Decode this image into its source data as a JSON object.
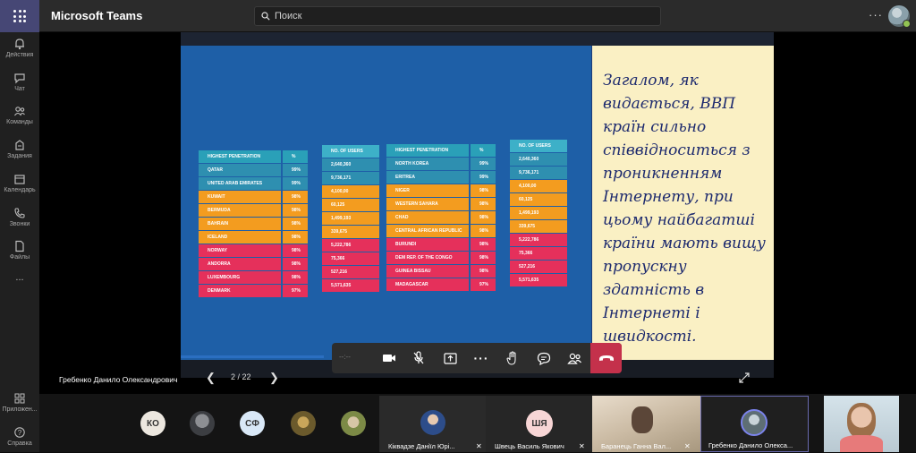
{
  "app": {
    "title": "Microsoft Teams"
  },
  "search": {
    "placeholder": "Поиск"
  },
  "rail": {
    "items": [
      {
        "label": "Действия",
        "icon": "bell-icon"
      },
      {
        "label": "Чат",
        "icon": "chat-icon"
      },
      {
        "label": "Команды",
        "icon": "teams-icon"
      },
      {
        "label": "Задания",
        "icon": "assignments-icon"
      },
      {
        "label": "Календарь",
        "icon": "calendar-icon"
      },
      {
        "label": "Звонки",
        "icon": "phone-icon"
      },
      {
        "label": "Файлы",
        "icon": "file-icon"
      },
      {
        "label": "...",
        "icon": "more-icon"
      },
      {
        "label": "Приложен...",
        "icon": "apps-icon"
      },
      {
        "label": "Справка",
        "icon": "help-icon"
      }
    ]
  },
  "slide": {
    "text": "Загалом, як видається, ВВП країн сильно співвідноситься з проникненням Інтернету, при цьому найбагатші країни мають вищу пропускну здатність в Інтернеті і швидкості.",
    "table_left": {
      "headers": [
        "HIGHEST PENETRATION",
        "%",
        "NO. OF USERS"
      ],
      "rows": [
        {
          "country": "QATAR",
          "pct": "99%",
          "users": "2,640,360",
          "band": "teal"
        },
        {
          "country": "UNITED ARAB EMIRATES",
          "pct": "99%",
          "users": "9,736,171",
          "band": "teal"
        },
        {
          "country": "KUWAIT",
          "pct": "98%",
          "users": "4,100,00",
          "band": "orange"
        },
        {
          "country": "BERMUDA",
          "pct": "98%",
          "users": "60,125",
          "band": "orange"
        },
        {
          "country": "BAHRAIN",
          "pct": "98%",
          "users": "1,499,193",
          "band": "orange"
        },
        {
          "country": "ICELAND",
          "pct": "98%",
          "users": "339,675",
          "band": "orange"
        },
        {
          "country": "NORWAY",
          "pct": "98%",
          "users": "5,222,786",
          "band": "pink"
        },
        {
          "country": "ANDORRA",
          "pct": "98%",
          "users": "75,366",
          "band": "pink"
        },
        {
          "country": "LUXEMBOURG",
          "pct": "98%",
          "users": "527,216",
          "band": "pink"
        },
        {
          "country": "DENMARK",
          "pct": "97%",
          "users": "5,571,635",
          "band": "pink"
        }
      ]
    },
    "table_right": {
      "headers": [
        "HIGHEST PENETRATION",
        "%",
        "NO. OF USERS"
      ],
      "rows": [
        {
          "country": "NORTH KOREA",
          "pct": "99%",
          "users": "2,640,360",
          "band": "teal"
        },
        {
          "country": "ERITREA",
          "pct": "99%",
          "users": "9,736,171",
          "band": "teal"
        },
        {
          "country": "NIGER",
          "pct": "98%",
          "users": "4,100,00",
          "band": "orange"
        },
        {
          "country": "WESTERN SAHARA",
          "pct": "98%",
          "users": "60,125",
          "band": "orange"
        },
        {
          "country": "CHAD",
          "pct": "98%",
          "users": "1,499,193",
          "band": "orange"
        },
        {
          "country": "CENTRAL AFRICAN REPUBLIC",
          "pct": "98%",
          "users": "339,675",
          "band": "orange"
        },
        {
          "country": "BURUNDI",
          "pct": "98%",
          "users": "5,222,786",
          "band": "pink"
        },
        {
          "country": "DEM REP. OF THE CONGO",
          "pct": "98%",
          "users": "75,366",
          "band": "pink"
        },
        {
          "country": "GUINEA BISSAU",
          "pct": "98%",
          "users": "527,216",
          "band": "pink"
        },
        {
          "country": "MADAGASCAR",
          "pct": "97%",
          "users": "5,571,635",
          "band": "pink"
        }
      ]
    }
  },
  "meeting": {
    "timer": "--:--",
    "presenter": "Гребенко Данило Олександрович",
    "page": "2 / 22",
    "controls": [
      "camera-icon",
      "mic-off-icon",
      "share-icon",
      "more-icon",
      "raise-hand-icon",
      "chat-icon",
      "participants-icon",
      "hangup-icon"
    ]
  },
  "participants": {
    "avatars": [
      {
        "initials": "КО",
        "color": "#e8e0d8"
      },
      {
        "initials": "",
        "color": "#5a5d61"
      },
      {
        "initials": "СФ",
        "color": "#d5e4f5"
      },
      {
        "initials": "",
        "color": "#8c7b4a"
      },
      {
        "initials": "",
        "color": "#9aa36a"
      }
    ],
    "tiles": [
      {
        "name": "Кіквадзе Даніїл Юрі...",
        "muted": true
      },
      {
        "name": "Швець Василь Якович",
        "initials": "ШЯ",
        "muted": true
      },
      {
        "name": "Баранець Ганна Вал...",
        "muted": true
      },
      {
        "name": "Гребенко Данило Олекса...",
        "muted": false
      },
      {
        "name": "",
        "muted": false
      }
    ]
  },
  "colors": {
    "teal": "#2e8fb0",
    "orange": "#f39c1f",
    "pink": "#e5305b",
    "accent": "#464775",
    "hangup": "#c4314b"
  }
}
